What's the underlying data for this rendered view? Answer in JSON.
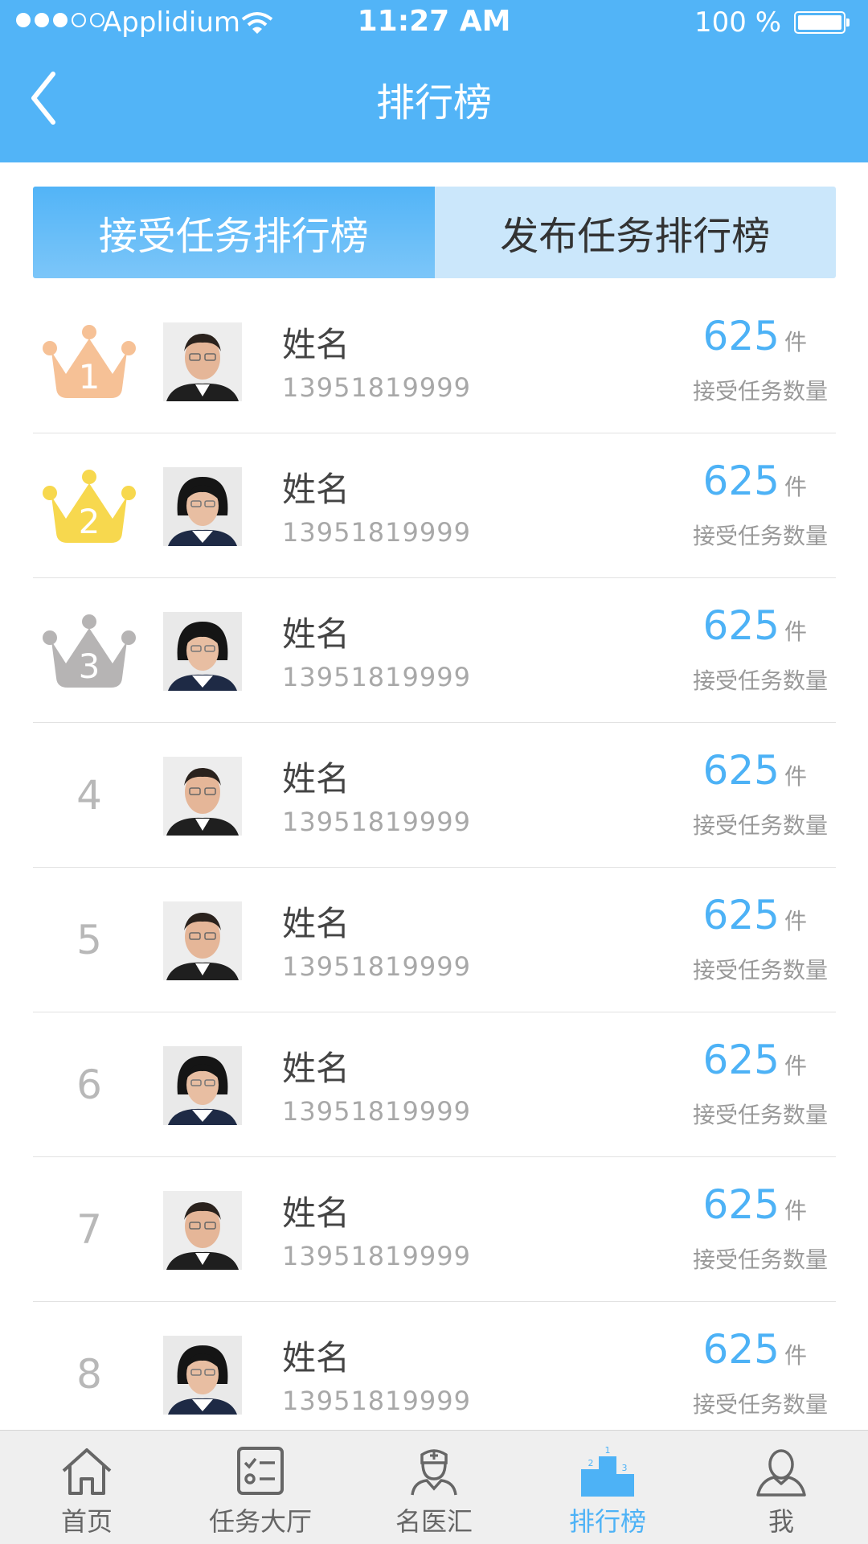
{
  "status_bar": {
    "carrier": "Applidium",
    "time": "11:27 AM",
    "battery": "100 %",
    "signal_bars": 3
  },
  "header": {
    "title": "排行榜"
  },
  "tabs": [
    {
      "label": "接受任务排行榜",
      "active": true
    },
    {
      "label": "发布任务排行榜",
      "active": false
    }
  ],
  "colors": {
    "accent": "#52b4f7",
    "gold": "#f7d84e",
    "bronze": "#f6c196",
    "silver": "#b6b4b4"
  },
  "ranking": [
    {
      "rank": "1",
      "badge": "crown-bronze",
      "avatar": "male",
      "name": "姓名",
      "phone": "13951819999",
      "count": "625",
      "unit": "件",
      "label": "接受任务数量"
    },
    {
      "rank": "2",
      "badge": "crown-gold",
      "avatar": "female",
      "name": "姓名",
      "phone": "13951819999",
      "count": "625",
      "unit": "件",
      "label": "接受任务数量"
    },
    {
      "rank": "3",
      "badge": "crown-silver",
      "avatar": "female",
      "name": "姓名",
      "phone": "13951819999",
      "count": "625",
      "unit": "件",
      "label": "接受任务数量"
    },
    {
      "rank": "4",
      "badge": "",
      "avatar": "male",
      "name": "姓名",
      "phone": "13951819999",
      "count": "625",
      "unit": "件",
      "label": "接受任务数量"
    },
    {
      "rank": "5",
      "badge": "",
      "avatar": "male",
      "name": "姓名",
      "phone": "13951819999",
      "count": "625",
      "unit": "件",
      "label": "接受任务数量"
    },
    {
      "rank": "6",
      "badge": "",
      "avatar": "female",
      "name": "姓名",
      "phone": "13951819999",
      "count": "625",
      "unit": "件",
      "label": "接受任务数量"
    },
    {
      "rank": "7",
      "badge": "",
      "avatar": "male",
      "name": "姓名",
      "phone": "13951819999",
      "count": "625",
      "unit": "件",
      "label": "接受任务数量"
    },
    {
      "rank": "8",
      "badge": "",
      "avatar": "female",
      "name": "姓名",
      "phone": "13951819999",
      "count": "625",
      "unit": "件",
      "label": "接受任务数量"
    }
  ],
  "tabbar": [
    {
      "label": "首页",
      "icon": "home-icon",
      "active": false
    },
    {
      "label": "任务大厅",
      "icon": "task-list-icon",
      "active": false
    },
    {
      "label": "名医汇",
      "icon": "doctor-icon",
      "active": false
    },
    {
      "label": "排行榜",
      "icon": "podium-icon",
      "active": true
    },
    {
      "label": "我",
      "icon": "user-icon",
      "active": false
    }
  ]
}
